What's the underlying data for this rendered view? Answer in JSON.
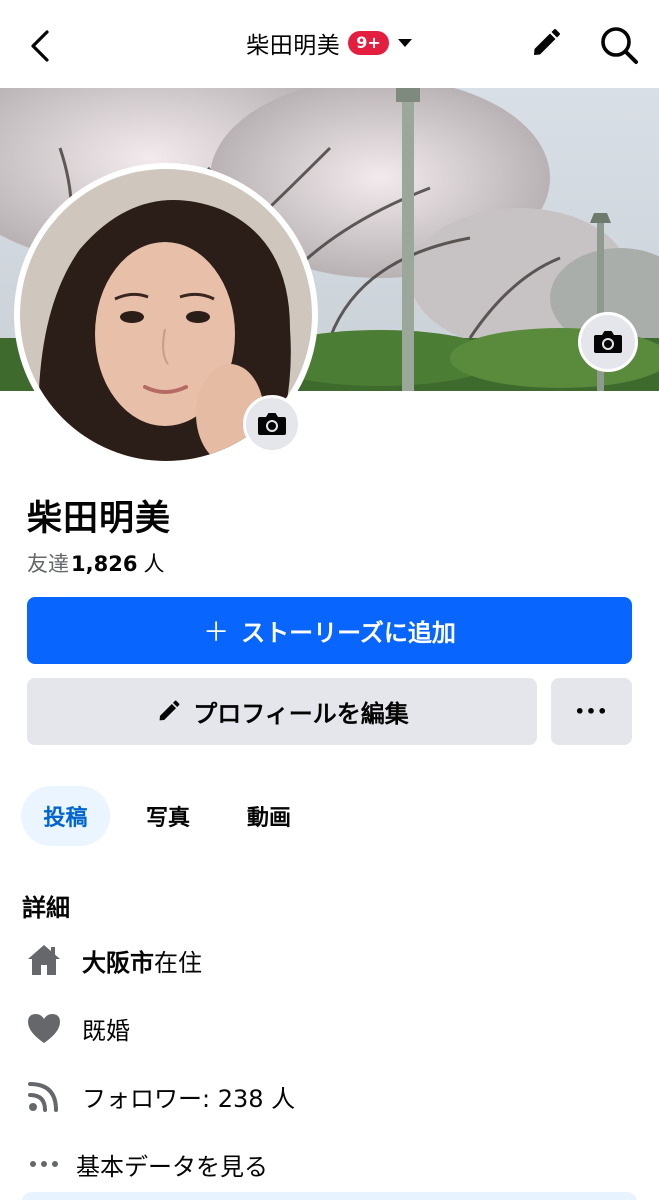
{
  "header": {
    "title": "柴田明美",
    "badge": "9+"
  },
  "profile": {
    "name": "柴田明美",
    "friends_prefix": "友達",
    "friends_count": "1,826",
    "friends_unit": "人"
  },
  "actions": {
    "add_story": "ストーリーズに追加",
    "add_story_icon": "＋",
    "edit_profile": "プロフィールを編集",
    "more": "•••"
  },
  "tabs": [
    {
      "label": "投稿",
      "active": true
    },
    {
      "label": "写真",
      "active": false
    },
    {
      "label": "動画",
      "active": false
    }
  ],
  "details": {
    "title": "詳細",
    "city": "大阪市",
    "city_suffix": "在住",
    "relationship": "既婚",
    "followers": "フォロワー: 238 人",
    "more_info": "基本データを見る"
  },
  "colors": {
    "primary": "#0866ff",
    "badge": "#e41e3f",
    "secondary_button": "#e4e6eb",
    "active_tab_bg": "#ebf5ff",
    "active_tab_text": "#0064d1",
    "icon_gray": "#65676b"
  },
  "icons": {
    "back": "chevron-left-icon",
    "caret": "caret-down-icon",
    "edit": "pencil-icon",
    "search": "search-icon",
    "camera": "camera-icon",
    "home": "home-icon",
    "heart": "heart-icon",
    "feed": "rss-icon",
    "more": "ellipsis-icon"
  }
}
